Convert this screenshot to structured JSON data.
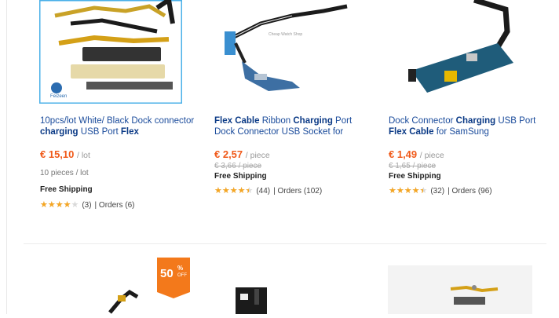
{
  "products": [
    {
      "title_parts": [
        {
          "text": "10pcs/lot White/ Black Dock connector ",
          "bold": false
        },
        {
          "text": "charging",
          "bold": true
        },
        {
          "text": " USB Port ",
          "bold": false
        },
        {
          "text": "Flex",
          "bold": true
        }
      ],
      "price": "€ 15,10",
      "unit": "/ lot",
      "old_price": "",
      "lot_info": "10 pieces / lot",
      "shipping": "Free Shipping",
      "rating": 4,
      "reviews": "(3)",
      "orders": "| Orders (6)",
      "brand_logo_text": "Feizeen"
    },
    {
      "title_parts": [
        {
          "text": "Flex Cable",
          "bold": true
        },
        {
          "text": " Ribbon ",
          "bold": false
        },
        {
          "text": "Charging",
          "bold": true
        },
        {
          "text": " Port Dock Connector USB Socket for",
          "bold": false
        }
      ],
      "price": "€ 2,57",
      "unit": "/ piece",
      "old_price": "€ 3,66 / piece",
      "lot_info": "",
      "shipping": "Free Shipping",
      "rating": 4.5,
      "reviews": "(44)",
      "orders": "| Orders (102)"
    },
    {
      "title_parts": [
        {
          "text": "Dock Connector ",
          "bold": false
        },
        {
          "text": "Charging",
          "bold": true
        },
        {
          "text": " USB Port ",
          "bold": false
        },
        {
          "text": "Flex Cable",
          "bold": true
        },
        {
          "text": " for SamSung",
          "bold": false
        }
      ],
      "price": "€ 1,49",
      "unit": "/ piece",
      "old_price": "€ 1,65 / piece",
      "lot_info": "",
      "shipping": "Free Shipping",
      "rating": 4.5,
      "reviews": "(32)",
      "orders": "| Orders (96)"
    }
  ],
  "discount_badge": {
    "number": "50",
    "percent": "%",
    "off": "OFF"
  }
}
